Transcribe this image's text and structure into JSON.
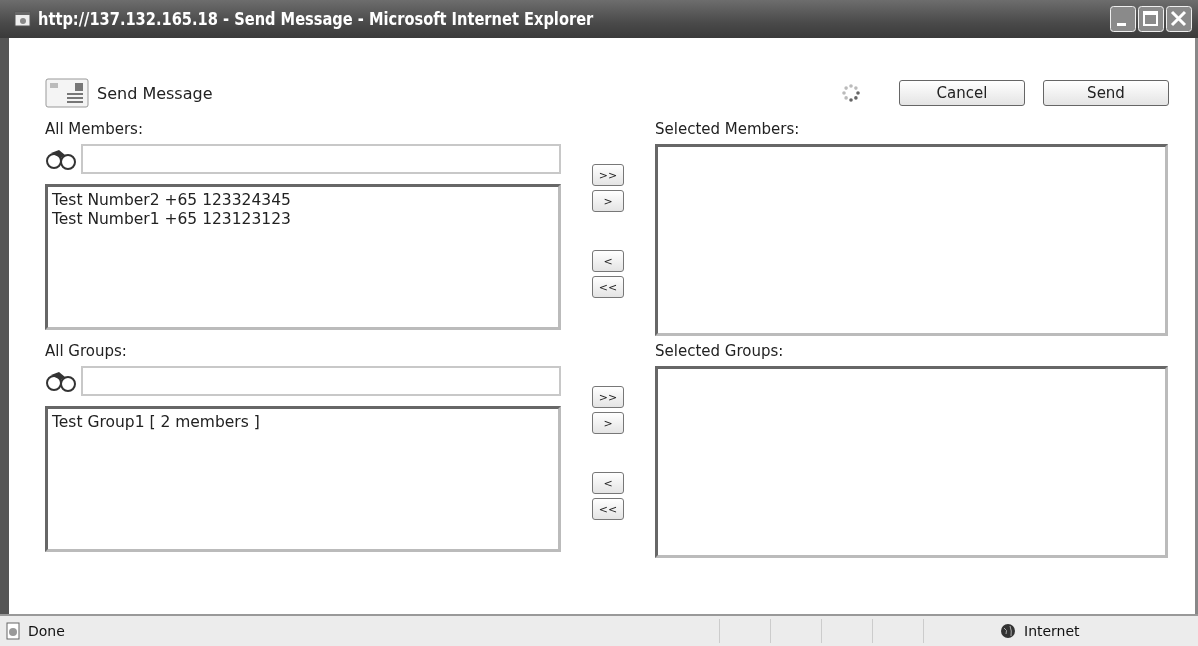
{
  "window": {
    "title": "http://137.132.165.18 - Send Message - Microsoft Internet Explorer"
  },
  "toolbar": {
    "title": "Send Message",
    "buttons": [
      "Cancel",
      "Send"
    ]
  },
  "sections": [
    {
      "available": {
        "label": "All Members:",
        "items": [
          "Test Number2 +65 123324345",
          "Test Number1 +65 123123123"
        ]
      },
      "move_buttons": [
        ">>",
        ">",
        "<",
        "<<"
      ],
      "chosen": {
        "label": "Selected Members:"
      }
    },
    {
      "available": {
        "label": "All Groups:",
        "items": [
          "Test Group1 [ 2 members ]"
        ]
      },
      "move_buttons": [
        ">>",
        ">",
        "<",
        "<<"
      ],
      "chosen": {
        "label": "Selected Groups:"
      }
    }
  ],
  "status_bar": {
    "text": "Done",
    "zone": "Internet"
  }
}
